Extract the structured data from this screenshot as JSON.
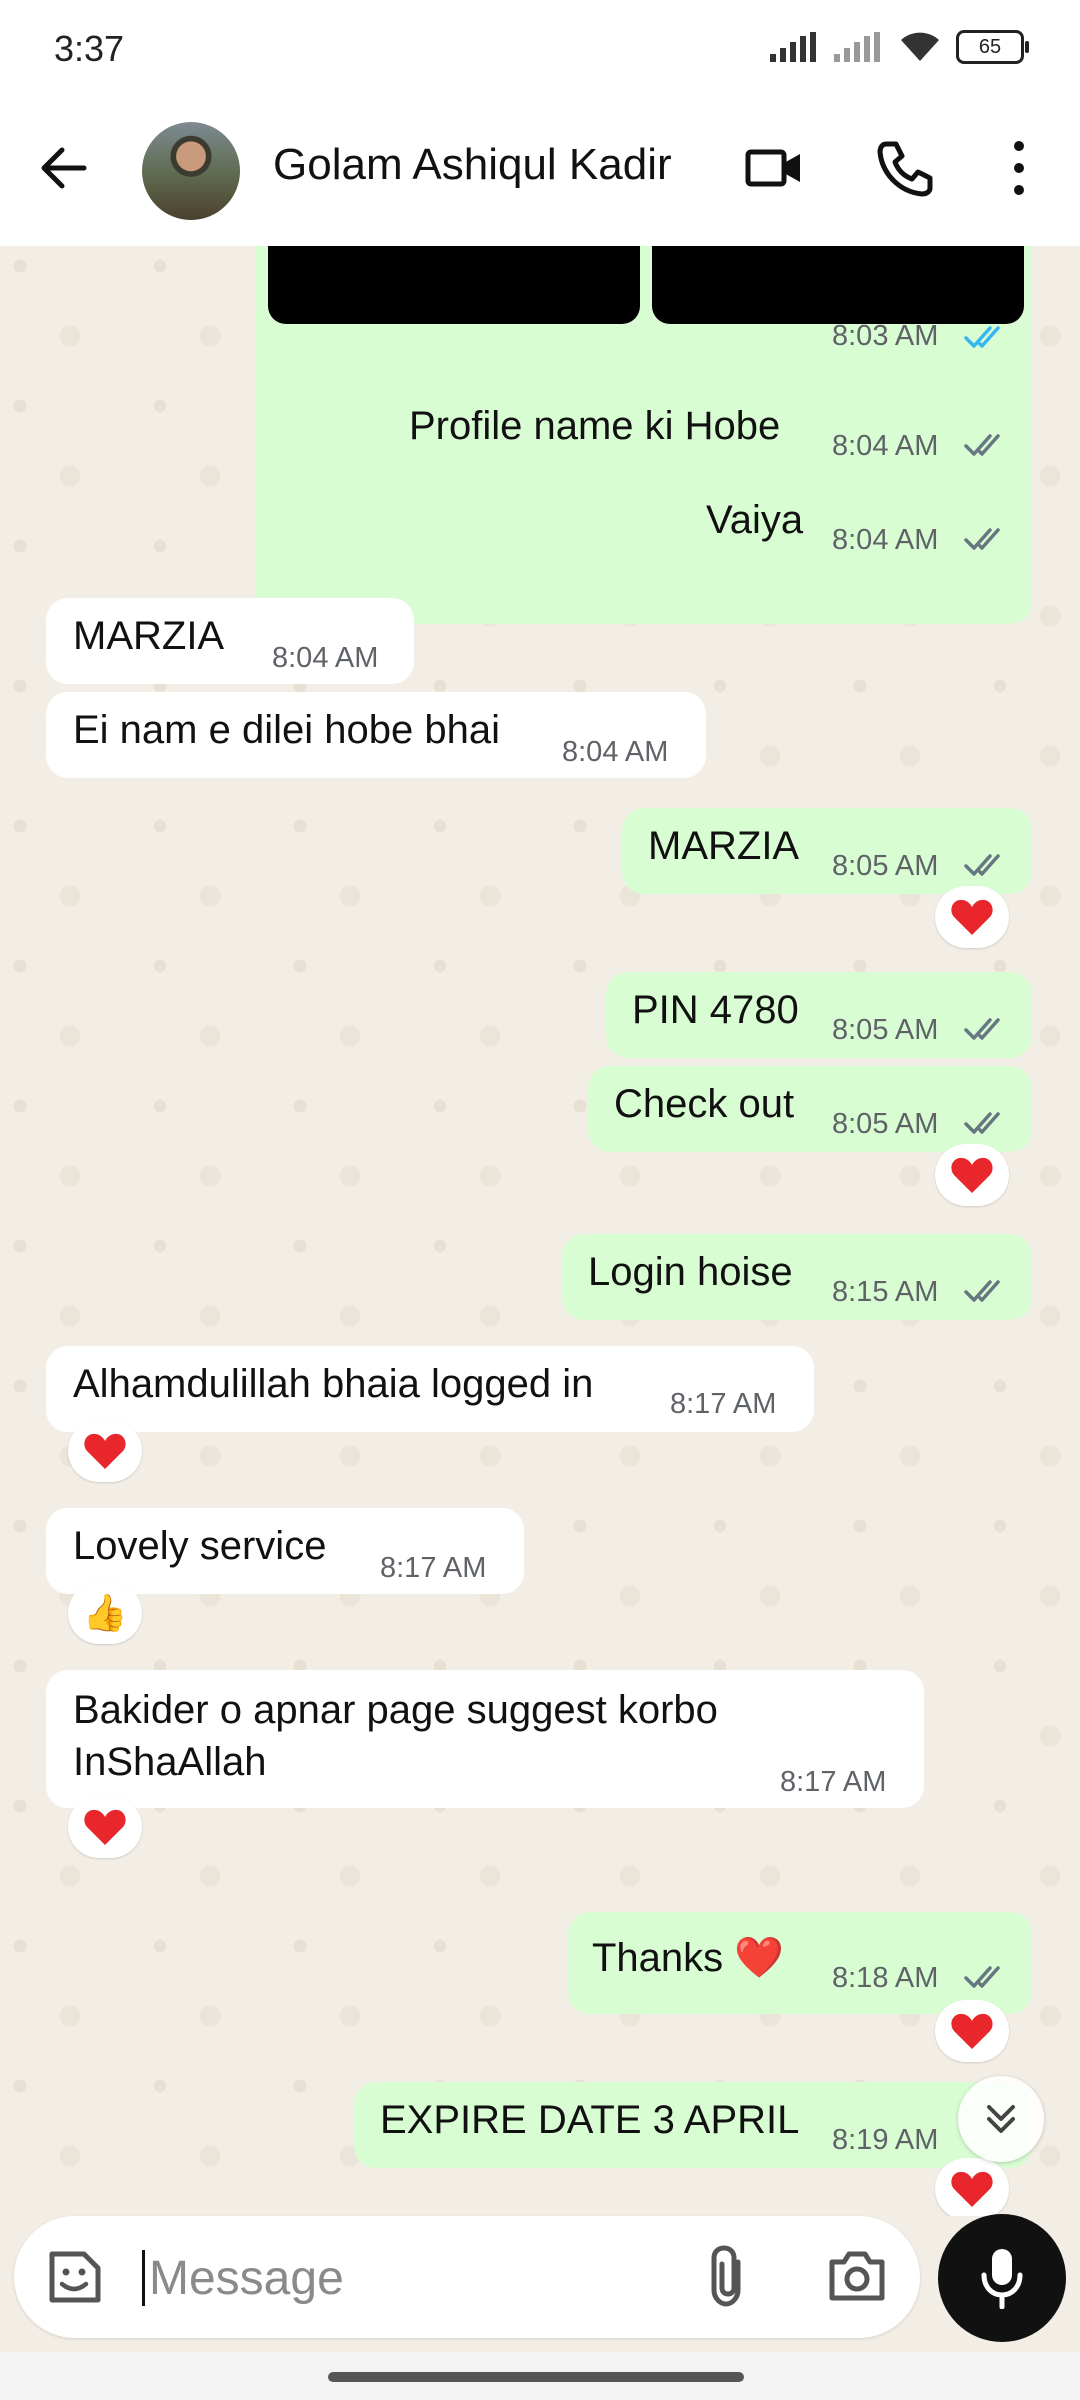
{
  "status_bar": {
    "time": "3:37",
    "battery": "65"
  },
  "header": {
    "contact_name": "Golam Ashiqul Kadir",
    "icons": [
      "back-arrow-icon",
      "video-call-icon",
      "phone-icon",
      "more-vert-icon"
    ]
  },
  "messages": [
    {
      "dir": "out",
      "text": "",
      "time": "8:03 AM",
      "status": "read",
      "type": "image"
    },
    {
      "dir": "out",
      "text": "Profile name ki Hobe",
      "time": "8:04 AM",
      "status": "delivered"
    },
    {
      "dir": "out",
      "text": "Vaiya",
      "time": "8:04 AM",
      "status": "delivered"
    },
    {
      "dir": "in",
      "text": "MARZIA",
      "time": "8:04 AM"
    },
    {
      "dir": "in",
      "text": "Ei nam e dilei hobe bhai",
      "time": "8:04 AM"
    },
    {
      "dir": "out",
      "text": "MARZIA",
      "time": "8:05 AM",
      "status": "delivered",
      "reaction": "❤️"
    },
    {
      "dir": "out",
      "text": "PIN 4780",
      "time": "8:05 AM",
      "status": "delivered"
    },
    {
      "dir": "out",
      "text": "Check out",
      "time": "8:05 AM",
      "status": "delivered",
      "reaction": "❤️"
    },
    {
      "dir": "out",
      "text": "Login hoise",
      "time": "8:15 AM",
      "status": "delivered"
    },
    {
      "dir": "in",
      "text": "Alhamdulillah bhaia logged in",
      "time": "8:17 AM",
      "reaction": "❤️"
    },
    {
      "dir": "in",
      "text": "Lovely service",
      "time": "8:17 AM",
      "reaction": "👍"
    },
    {
      "dir": "in",
      "text_line1": "Bakider o apnar page suggest korbo",
      "text_line2": "InShaAllah",
      "time": "8:17 AM",
      "reaction": "❤️"
    },
    {
      "dir": "out",
      "text": "Thanks ❤️",
      "time": "8:18 AM",
      "status": "delivered",
      "reaction": "❤️"
    },
    {
      "dir": "out",
      "text": "EXPIRE DATE  3 APRIL",
      "time": "8:19 AM",
      "reaction": "❤️"
    }
  ],
  "composer": {
    "placeholder": "Message"
  },
  "colors": {
    "outgoing_bubble": "#d9fdd3",
    "incoming_bubble": "#ffffff",
    "read_tick": "#34b7f1",
    "delivered_tick": "#667781"
  }
}
